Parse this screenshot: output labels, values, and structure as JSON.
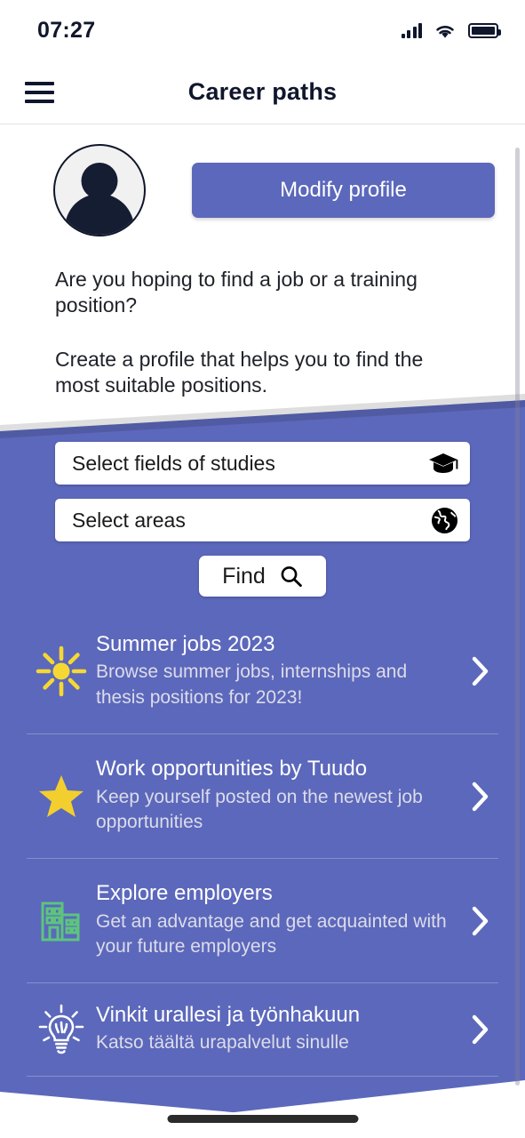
{
  "status_bar": {
    "time": "07:27",
    "signal_icon": "signal-bars-icon",
    "wifi_icon": "wifi-icon",
    "battery_icon": "battery-full-icon"
  },
  "app_bar": {
    "menu_icon": "hamburger-menu-icon",
    "title": "Career paths"
  },
  "profile": {
    "avatar_icon": "person-avatar-icon",
    "modify_button_label": "Modify profile"
  },
  "intro": {
    "paragraph_1": "Are you hoping to find a job or a training position?",
    "paragraph_2": "Create a profile that helps you to find the most suitable positions."
  },
  "search": {
    "fields_select_label": "Select fields of studies",
    "fields_select_icon": "graduation-cap-icon",
    "areas_select_label": "Select areas",
    "areas_select_icon": "globe-icon",
    "find_button_label": "Find",
    "find_button_icon": "search-icon"
  },
  "links": [
    {
      "icon": "sun-icon",
      "title": "Summer jobs 2023",
      "subtitle": "Browse summer jobs, internships and thesis positions for 2023!",
      "chevron": "chevron-right-icon"
    },
    {
      "icon": "star-icon",
      "title": "Work opportunities by Tuudo",
      "subtitle": "Keep yourself posted on the newest job opportunities",
      "chevron": "chevron-right-icon"
    },
    {
      "icon": "building-icon",
      "title": "Explore employers",
      "subtitle": "Get an advantage and get acquainted with your future employers",
      "chevron": "chevron-right-icon"
    },
    {
      "icon": "lightbulb-icon",
      "title": "Vinkit urallesi ja työnhakuun",
      "subtitle": "Katso täältä urapalvelut sinulle",
      "chevron": "chevron-right-icon"
    }
  ],
  "colors": {
    "brand_blue": "#5c68bb",
    "dark_navy": "#10162b",
    "sun_yellow": "#f5d833",
    "star_yellow": "#f2cf2e",
    "building_green": "#5cc47e",
    "page_white": "#ffffff"
  }
}
